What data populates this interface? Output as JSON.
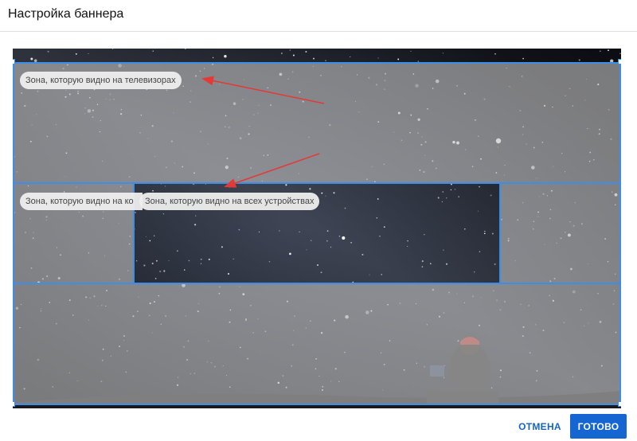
{
  "dialog": {
    "title": "Настройка баннера"
  },
  "zones": {
    "tv_label": "Зона, которую видно на телевизорах",
    "desktop_label": "Зона, которую видно на ко",
    "all_devices_label": "Зона, которую видно на всех устройствах"
  },
  "footer": {
    "cancel_label": "ОТМЕНА",
    "done_label": "ГОТОВО"
  },
  "colors": {
    "guide": "#3d8ee8",
    "arrow": "#e53935",
    "primary_button": "#1565d2",
    "cancel_text": "#1565c0"
  }
}
